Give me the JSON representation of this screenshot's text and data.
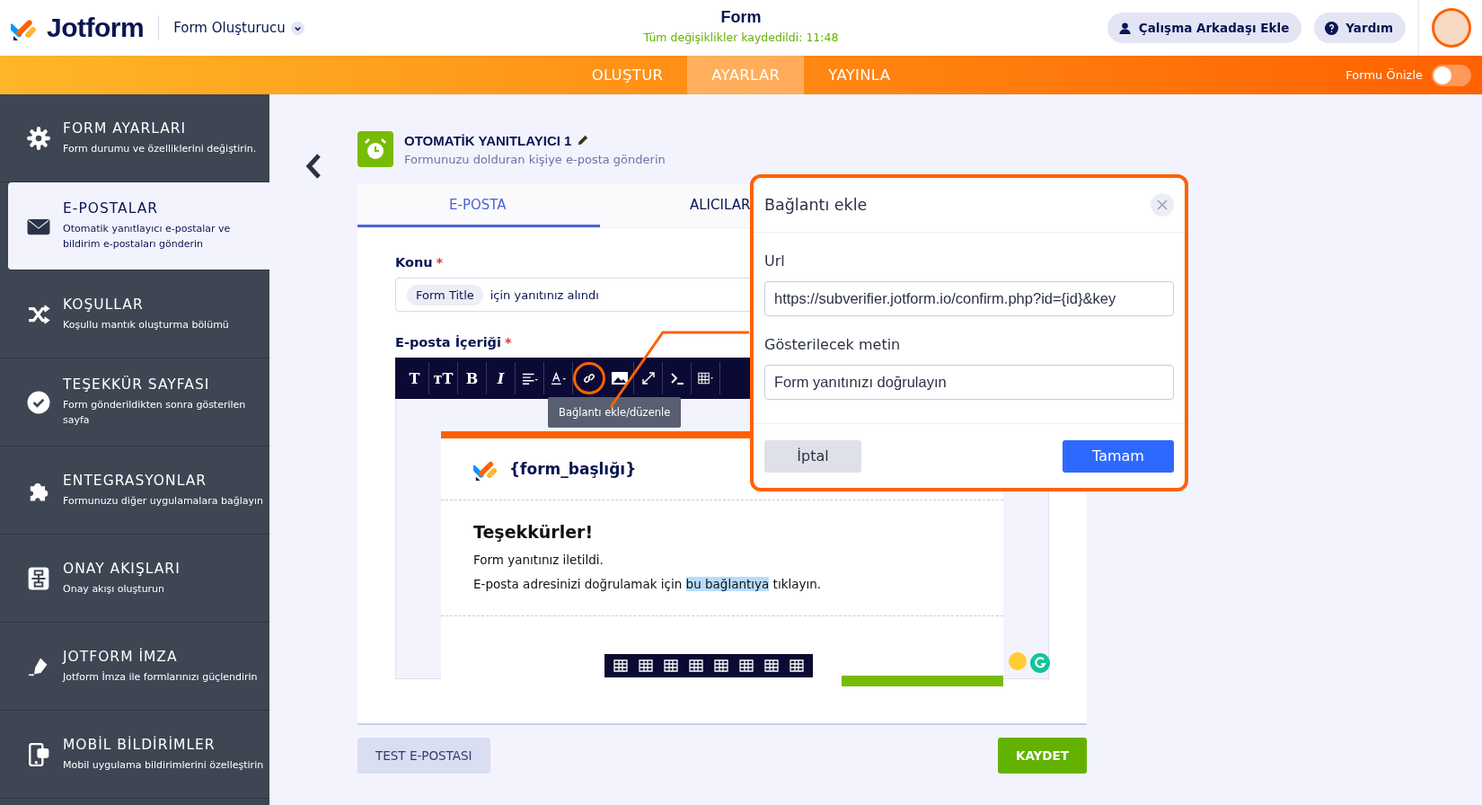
{
  "header": {
    "logo": "Jotform",
    "builder_menu": "Form Oluşturucu",
    "form_title": "Form",
    "save_status": "Tüm değişiklikler kaydedildi: 11:48",
    "buttons": [
      {
        "kind": "person",
        "label": "Çalışma Arkadaşı Ekle"
      },
      {
        "kind": "help",
        "label": "Yardım"
      }
    ]
  },
  "nav_tabs": [
    {
      "label": "OLUŞTUR",
      "selected": false
    },
    {
      "label": "AYARLAR",
      "selected": true
    },
    {
      "label": "YAYINLA",
      "selected": false
    }
  ],
  "preview_toggle": {
    "label": "Formu Önizle",
    "on": false
  },
  "sidebar": {
    "items": [
      {
        "kind": "gear",
        "title": "FORM AYARLARI",
        "subtitle": "Form durumu ve özelliklerini değiştirin.",
        "selected": false
      },
      {
        "kind": "mail",
        "title": "E-POSTALAR",
        "subtitle": "Otomatik yanıtlayıcı e-postalar ve bildirim e-postaları gönderin",
        "selected": true
      },
      {
        "kind": "shuffle",
        "title": "KOŞULLAR",
        "subtitle": "Koşullu mantık oluşturma bölümü",
        "selected": false
      },
      {
        "kind": "check",
        "title": "TEŞEKKÜR SAYFASI",
        "subtitle": "Form gönderildikten sonra gösterilen sayfa",
        "selected": false
      },
      {
        "kind": "puzzle",
        "title": "ENTEGRASYONLAR",
        "subtitle": "Formunuzu diğer uygulamalara bağlayın",
        "selected": false
      },
      {
        "kind": "flow",
        "title": "ONAY AKIŞLARI",
        "subtitle": "Onay akışı oluşturun",
        "selected": false
      },
      {
        "kind": "pen",
        "title": "JOTFORM İMZA",
        "subtitle": "Jotform İmza ile formlarınızı güçlendirin",
        "selected": false
      },
      {
        "kind": "mobile",
        "title": "MOBİL BİLDİRİMLER",
        "subtitle": "Mobil uygulama bildirimlerini özelleştirin",
        "selected": false
      }
    ]
  },
  "autoresponder": {
    "title": "OTOMATİK YANITLAYICI 1",
    "subtitle": "Formunuzu dolduran kişiye e-posta gönderin"
  },
  "tabs": [
    {
      "label": "E-POSTA",
      "selected": true
    },
    {
      "label": "ALICILAR",
      "selected": false
    }
  ],
  "subject": {
    "label": "Konu",
    "required_mark": "*",
    "tag": "Form Title",
    "text": "için yanıtınız alındı"
  },
  "content": {
    "label": "E-posta İçeriği",
    "required_mark": "*",
    "toolbar": [
      {
        "kind": "text",
        "label": "T",
        "selected": false
      },
      {
        "kind": "text",
        "label": "тT",
        "selected": false
      },
      {
        "kind": "text",
        "label": "B",
        "selected": false
      },
      {
        "kind": "text",
        "label": "I",
        "selected": false
      },
      {
        "kind": "align",
        "selected": false
      },
      {
        "kind": "color",
        "selected": false
      },
      {
        "kind": "link",
        "selected": true
      },
      {
        "kind": "image",
        "selected": false
      },
      {
        "kind": "expand",
        "selected": false
      },
      {
        "kind": "code",
        "selected": false
      },
      {
        "kind": "table",
        "selected": false
      }
    ],
    "tooltip": "Bağlantı ekle/düzenle"
  },
  "email": {
    "header": "{form_başlığı}",
    "heading": "Teşekkürler!",
    "line1": "Form yanıtınız iletildi.",
    "line2_before": "E-posta adresinizi doğrulamak için ",
    "line2_selected": "bu bağlantıya",
    "line2_after": " tıklayın."
  },
  "dialog": {
    "title": "Bağlantı ekle",
    "url_label": "Url",
    "url_value": "https://subverifier.jotform.io/confirm.php?id={id}&key",
    "text_label": "Gösterilecek metin",
    "text_value": "Form yanıtınızı doğrulayın",
    "cancel": "İptal",
    "ok": "Tamam"
  },
  "footer": {
    "test": "TEST E-POSTASI",
    "save": "KAYDET"
  }
}
